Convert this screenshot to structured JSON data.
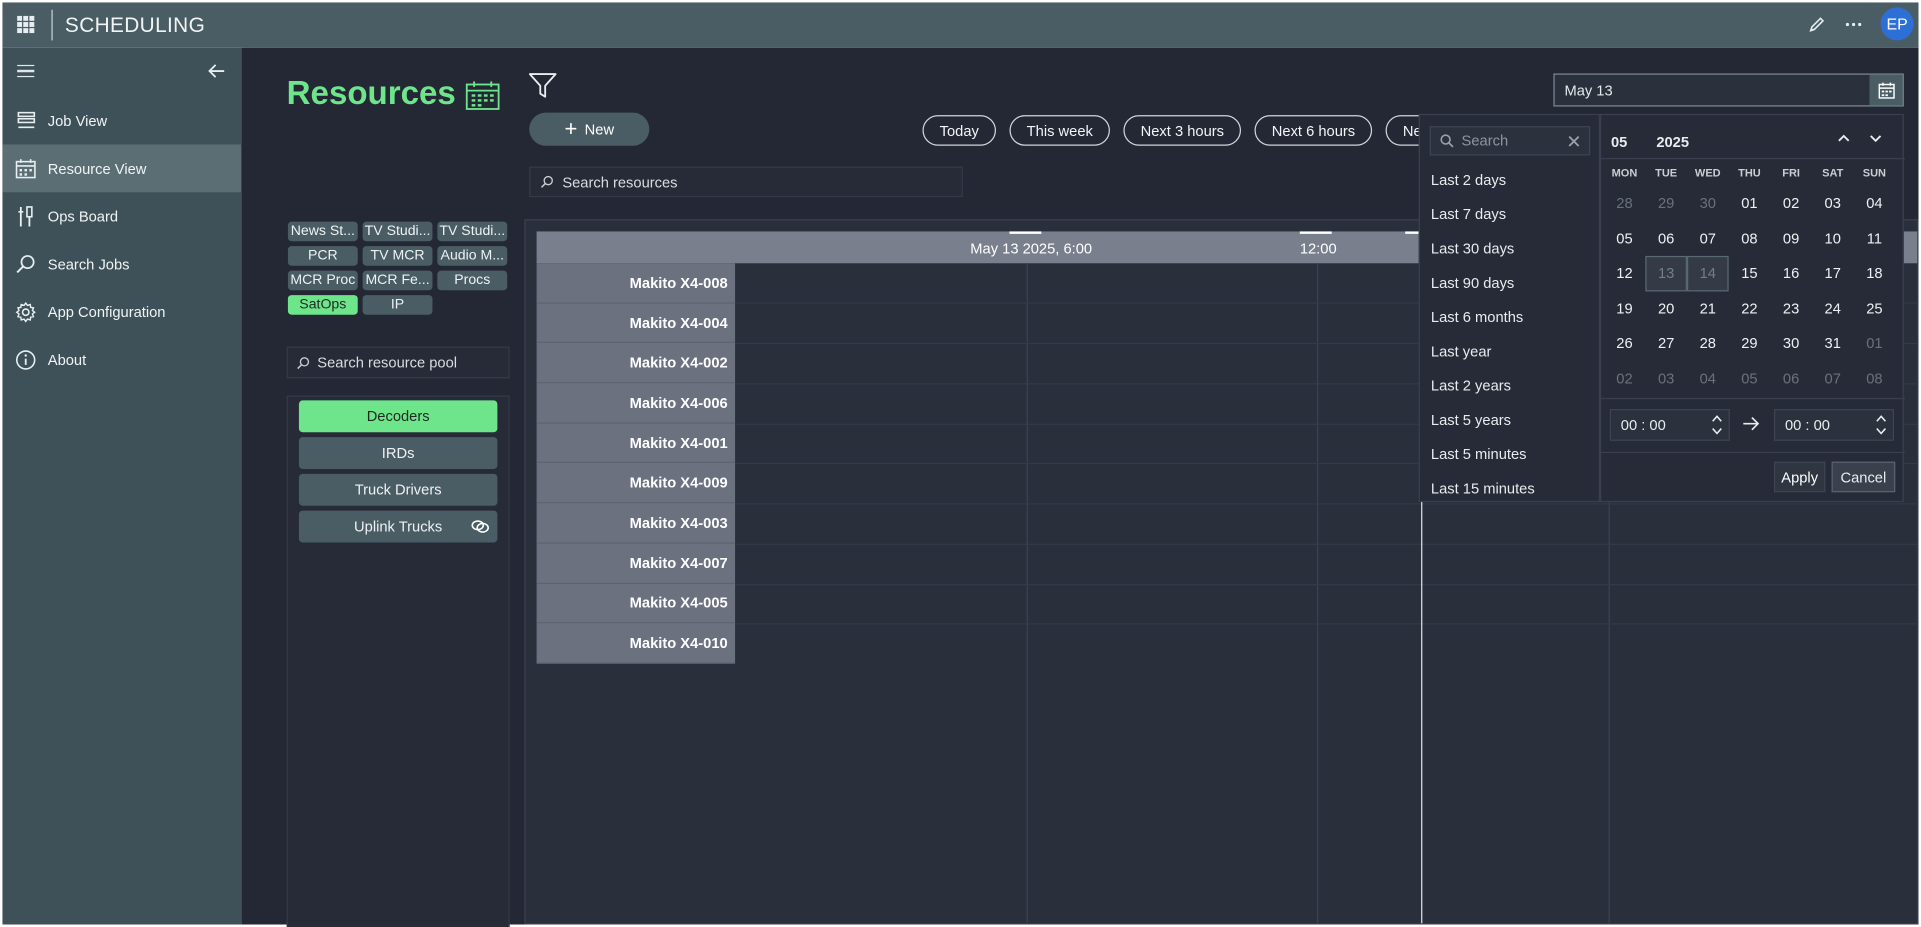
{
  "app": {
    "title": "SCHEDULING",
    "user_initials": "EP"
  },
  "sidebar": {
    "items": [
      {
        "label": "Job View",
        "icon": "job-view-icon"
      },
      {
        "label": "Resource View",
        "icon": "calendar-icon",
        "active": true
      },
      {
        "label": "Ops Board",
        "icon": "ops-board-icon"
      },
      {
        "label": "Search Jobs",
        "icon": "search-icon"
      },
      {
        "label": "App Configuration",
        "icon": "gear-icon"
      },
      {
        "label": "About",
        "icon": "info-icon"
      }
    ]
  },
  "main": {
    "title": "Resources",
    "new_label": "New",
    "range_buttons": [
      "Today",
      "This week",
      "Next 3 hours",
      "Next 6 hours",
      "Next"
    ],
    "search_resources_placeholder": "Search resources",
    "date_value": "May 13",
    "pool_chips": [
      {
        "label": "News St...",
        "active": false
      },
      {
        "label": "TV Studi...",
        "active": false
      },
      {
        "label": "TV Studi...",
        "active": false
      },
      {
        "label": "PCR",
        "active": false
      },
      {
        "label": "TV MCR",
        "active": false
      },
      {
        "label": "Audio M...",
        "active": false
      },
      {
        "label": "MCR Proc",
        "active": false
      },
      {
        "label": "MCR Fe...",
        "active": false
      },
      {
        "label": "Procs",
        "active": false
      },
      {
        "label": "SatOps",
        "active": true
      },
      {
        "label": "IP",
        "active": false
      }
    ],
    "search_pool_placeholder": "Search resource pool",
    "pool_types": [
      {
        "label": "Decoders",
        "active": true
      },
      {
        "label": "IRDs",
        "active": false
      },
      {
        "label": "Truck Drivers",
        "active": false
      },
      {
        "label": "Uplink Trucks",
        "active": false,
        "icon": "link-icon"
      }
    ]
  },
  "timeline": {
    "header_labels": [
      "May 13 2025, 6:00",
      "12:00"
    ],
    "resources": [
      "Makito X4-008",
      "Makito X4-004",
      "Makito X4-002",
      "Makito X4-006",
      "Makito X4-001",
      "Makito X4-009",
      "Makito X4-003",
      "Makito X4-007",
      "Makito X4-005",
      "Makito X4-010"
    ]
  },
  "date_picker": {
    "search_placeholder": "Search",
    "presets": [
      "Last 2 days",
      "Last 7 days",
      "Last 30 days",
      "Last 90 days",
      "Last 6 months",
      "Last year",
      "Last 2 years",
      "Last 5 years",
      "Last 5 minutes",
      "Last 15 minutes"
    ],
    "month": "05",
    "year": "2025",
    "weekdays": [
      "MON",
      "TUE",
      "WED",
      "THU",
      "FRI",
      "SAT",
      "SUN"
    ],
    "days": [
      [
        "28",
        "29",
        "30",
        "01",
        "02",
        "03",
        "04"
      ],
      [
        "05",
        "06",
        "07",
        "08",
        "09",
        "10",
        "11"
      ],
      [
        "12",
        "13",
        "14",
        "15",
        "16",
        "17",
        "18"
      ],
      [
        "19",
        "20",
        "21",
        "22",
        "23",
        "24",
        "25"
      ],
      [
        "26",
        "27",
        "28",
        "29",
        "30",
        "31",
        "01"
      ],
      [
        "02",
        "03",
        "04",
        "05",
        "06",
        "07",
        "08"
      ]
    ],
    "muted_days": [
      "0-0",
      "0-1",
      "0-2",
      "4-6",
      "5-0",
      "5-1",
      "5-2",
      "5-3",
      "5-4",
      "5-5",
      "5-6"
    ],
    "selected_days": [
      "2-1",
      "2-2"
    ],
    "start_time": "00 : 00",
    "end_time": "00 : 00",
    "apply_label": "Apply",
    "cancel_label": "Cancel"
  }
}
